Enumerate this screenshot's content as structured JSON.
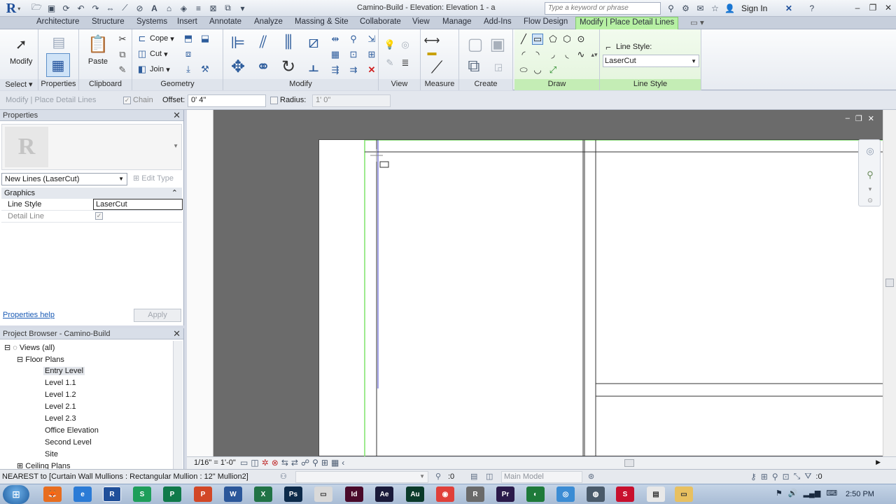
{
  "titlebar": {
    "title": "Camino-Build - Elevation: Elevation 1 - a",
    "search_placeholder": "Type a keyword or phrase",
    "sign_in": "Sign In"
  },
  "tabs": [
    "Architecture",
    "Structure",
    "Systems",
    "Insert",
    "Annotate",
    "Analyze",
    "Massing & Site",
    "Collaborate",
    "View",
    "Manage",
    "Add-Ins",
    "Flow Design",
    "Modify | Place Detail Lines"
  ],
  "ribbon": {
    "modify_label": "Modify",
    "select_label": "Select",
    "properties_label": "Properties",
    "clipboard": {
      "label": "Clipboard",
      "paste": "Paste"
    },
    "geometry": {
      "label": "Geometry",
      "cope": "Cope",
      "cut": "Cut",
      "join": "Join"
    },
    "modify_panel": "Modify",
    "view_panel": "View",
    "measure_panel": "Measure",
    "create_panel": "Create",
    "draw_panel": "Draw",
    "line_style_panel": {
      "label": "Line Style",
      "caption": "Line Style:",
      "value": "LaserCut"
    }
  },
  "options_bar": {
    "context": "Modify | Place Detail Lines",
    "chain": "Chain",
    "offset_label": "Offset:",
    "offset_value": "0' 4\"",
    "radius_label": "Radius:",
    "radius_value": "1' 0\""
  },
  "properties": {
    "title": "Properties",
    "type_name": "New Lines (LaserCut)",
    "edit_type": "Edit Type",
    "group": "Graphics",
    "rows": [
      {
        "key": "Line Style",
        "value": "LaserCut"
      },
      {
        "key": "Detail Line",
        "value": "✓"
      }
    ],
    "help": "Properties help",
    "apply": "Apply"
  },
  "browser": {
    "title": "Project Browser - Camino-Build",
    "root": "Views (all)",
    "floor_plans": "Floor Plans",
    "levels": [
      "Entry Level",
      "Level 1.1",
      "Level 1.2",
      "Level 2.1",
      "Level 2.3",
      "Office Elevation",
      "Second Level",
      "Site"
    ],
    "ceiling_plans": "Ceiling Plans"
  },
  "viewbar": {
    "scale": "1/16\" = 1'-0\""
  },
  "status": {
    "text": "NEAREST  to [Curtain Wall Mullions : Rectangular Mullion : 12\" Mullion2]",
    "worksets_count": ":0",
    "model": "Main Model",
    "filter_count": ":0"
  },
  "taskbar": {
    "time": "2:50 PM",
    "apps": [
      "Firefox",
      "IE",
      "Revit",
      "Sheets",
      "Publisher",
      "PowerPoint",
      "Word",
      "Excel",
      "Photoshop",
      "Explorer",
      "InDesign",
      "After Effects",
      "Audition",
      "Chrome",
      "Revit Pro",
      "Premiere",
      "Camtasia",
      "Safari",
      "Vivaldi",
      "SketchUp",
      "Notepad",
      "Folder"
    ]
  },
  "colors": {
    "active_tab": "#b6f0a3",
    "accent_blue": "#1f4f9a",
    "canvas_gray": "#6b6b6b",
    "draw_line_green": "#7fe36a"
  }
}
